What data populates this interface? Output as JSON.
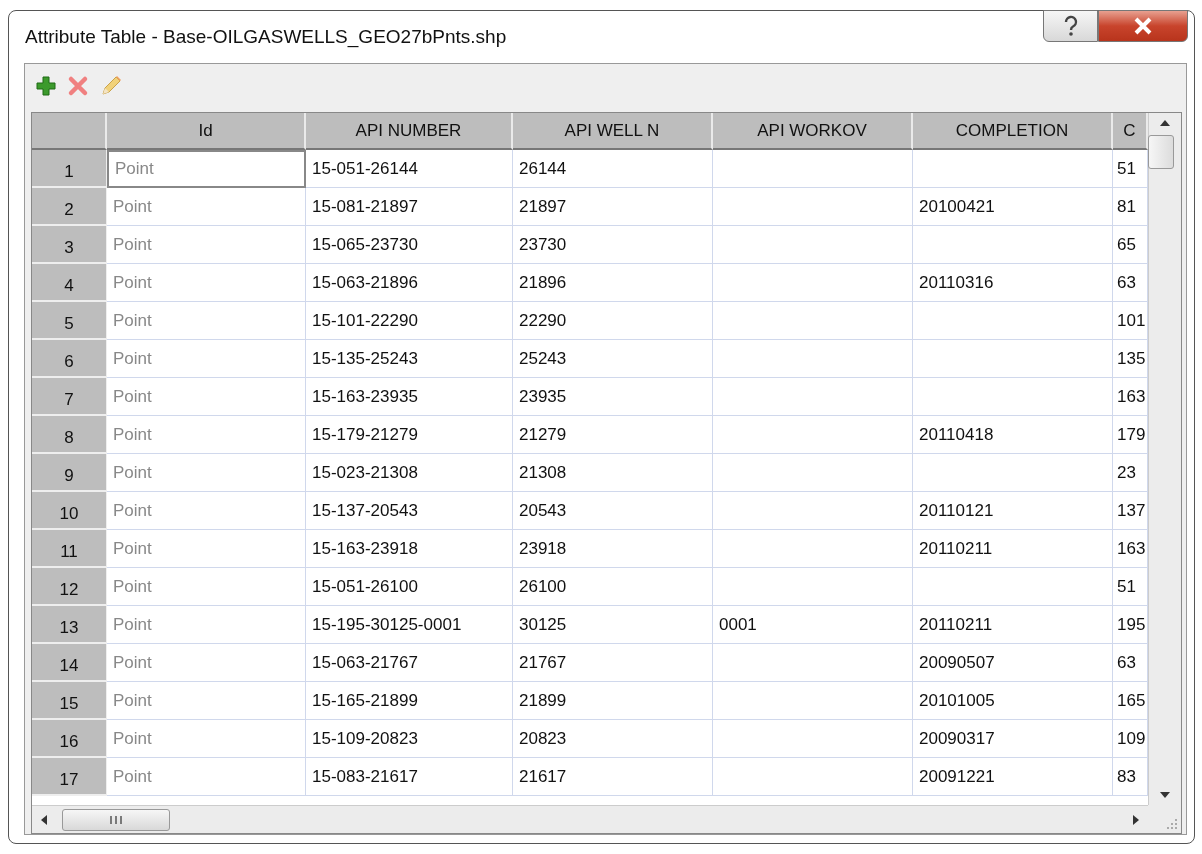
{
  "window": {
    "title": "Attribute Table - Base-OILGASWELLS_GEO27bPnts.shp"
  },
  "toolbar": [
    {
      "kind": "add"
    },
    {
      "kind": "delete"
    },
    {
      "kind": "edit"
    }
  ],
  "table": {
    "columns": [
      "Id",
      "API NUMBER",
      "API WELL N",
      "API WORKOV",
      "COMPLETION",
      "C"
    ],
    "rows": [
      {
        "header": "1",
        "focused": true,
        "cells": [
          "Point",
          "15-051-26144",
          "26144",
          "",
          "",
          "51"
        ]
      },
      {
        "header": "2",
        "focused": false,
        "cells": [
          "Point",
          "15-081-21897",
          "21897",
          "",
          "20100421",
          "81"
        ]
      },
      {
        "header": "3",
        "focused": false,
        "cells": [
          "Point",
          "15-065-23730",
          "23730",
          "",
          "",
          "65"
        ]
      },
      {
        "header": "4",
        "focused": false,
        "cells": [
          "Point",
          "15-063-21896",
          "21896",
          "",
          "20110316",
          "63"
        ]
      },
      {
        "header": "5",
        "focused": false,
        "cells": [
          "Point",
          "15-101-22290",
          "22290",
          "",
          "",
          "101"
        ]
      },
      {
        "header": "6",
        "focused": false,
        "cells": [
          "Point",
          "15-135-25243",
          "25243",
          "",
          "",
          "135"
        ]
      },
      {
        "header": "7",
        "focused": false,
        "cells": [
          "Point",
          "15-163-23935",
          "23935",
          "",
          "",
          "163"
        ]
      },
      {
        "header": "8",
        "focused": false,
        "cells": [
          "Point",
          "15-179-21279",
          "21279",
          "",
          "20110418",
          "179"
        ]
      },
      {
        "header": "9",
        "focused": false,
        "cells": [
          "Point",
          "15-023-21308",
          "21308",
          "",
          "",
          "23"
        ]
      },
      {
        "header": "10",
        "focused": false,
        "cells": [
          "Point",
          "15-137-20543",
          "20543",
          "",
          "20110121",
          "137"
        ]
      },
      {
        "header": "11",
        "focused": false,
        "cells": [
          "Point",
          "15-163-23918",
          "23918",
          "",
          "20110211",
          "163"
        ]
      },
      {
        "header": "12",
        "focused": false,
        "cells": [
          "Point",
          "15-051-26100",
          "26100",
          "",
          "",
          "51"
        ]
      },
      {
        "header": "13",
        "focused": false,
        "cells": [
          "Point",
          "15-195-30125-0001",
          "30125",
          "0001",
          "20110211",
          "195"
        ]
      },
      {
        "header": "14",
        "focused": false,
        "cells": [
          "Point",
          "15-063-21767",
          "21767",
          "",
          "20090507",
          "63"
        ]
      },
      {
        "header": "15",
        "focused": false,
        "cells": [
          "Point",
          "15-165-21899",
          "21899",
          "",
          "20101005",
          "165"
        ]
      },
      {
        "header": "16",
        "focused": false,
        "cells": [
          "Point",
          "15-109-20823",
          "20823",
          "",
          "20090317",
          "109"
        ]
      },
      {
        "header": "17",
        "focused": false,
        "cells": [
          "Point",
          "15-083-21617",
          "21617",
          "",
          "20091221",
          "83"
        ]
      }
    ]
  }
}
